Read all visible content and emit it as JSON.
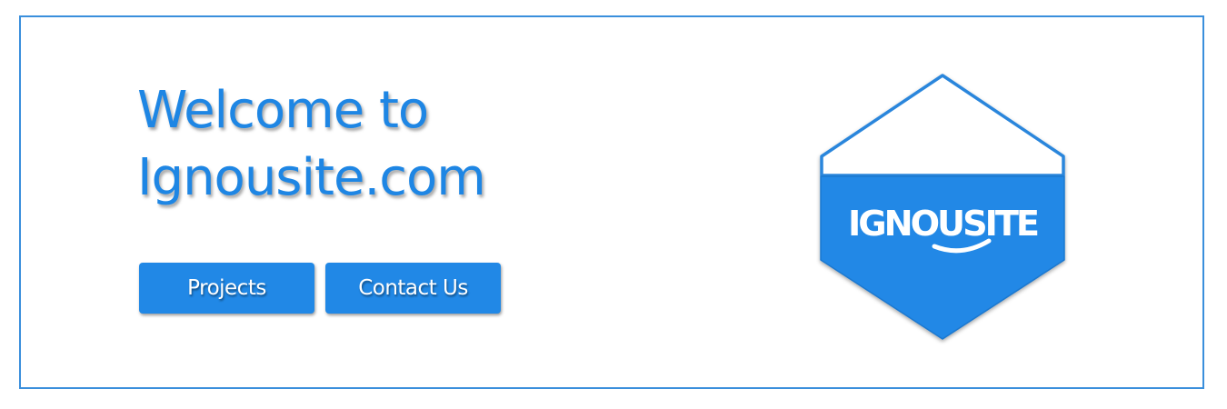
{
  "hero": {
    "title_line1": "Welcome to",
    "title_line2": "Ignousite.com"
  },
  "buttons": {
    "projects_label": "Projects",
    "contact_label": "Contact Us"
  },
  "logo": {
    "text": "IGNOUSITE"
  },
  "colors": {
    "accent": "#2188e6",
    "border": "#3a8fdc",
    "background": "#ffffff"
  }
}
